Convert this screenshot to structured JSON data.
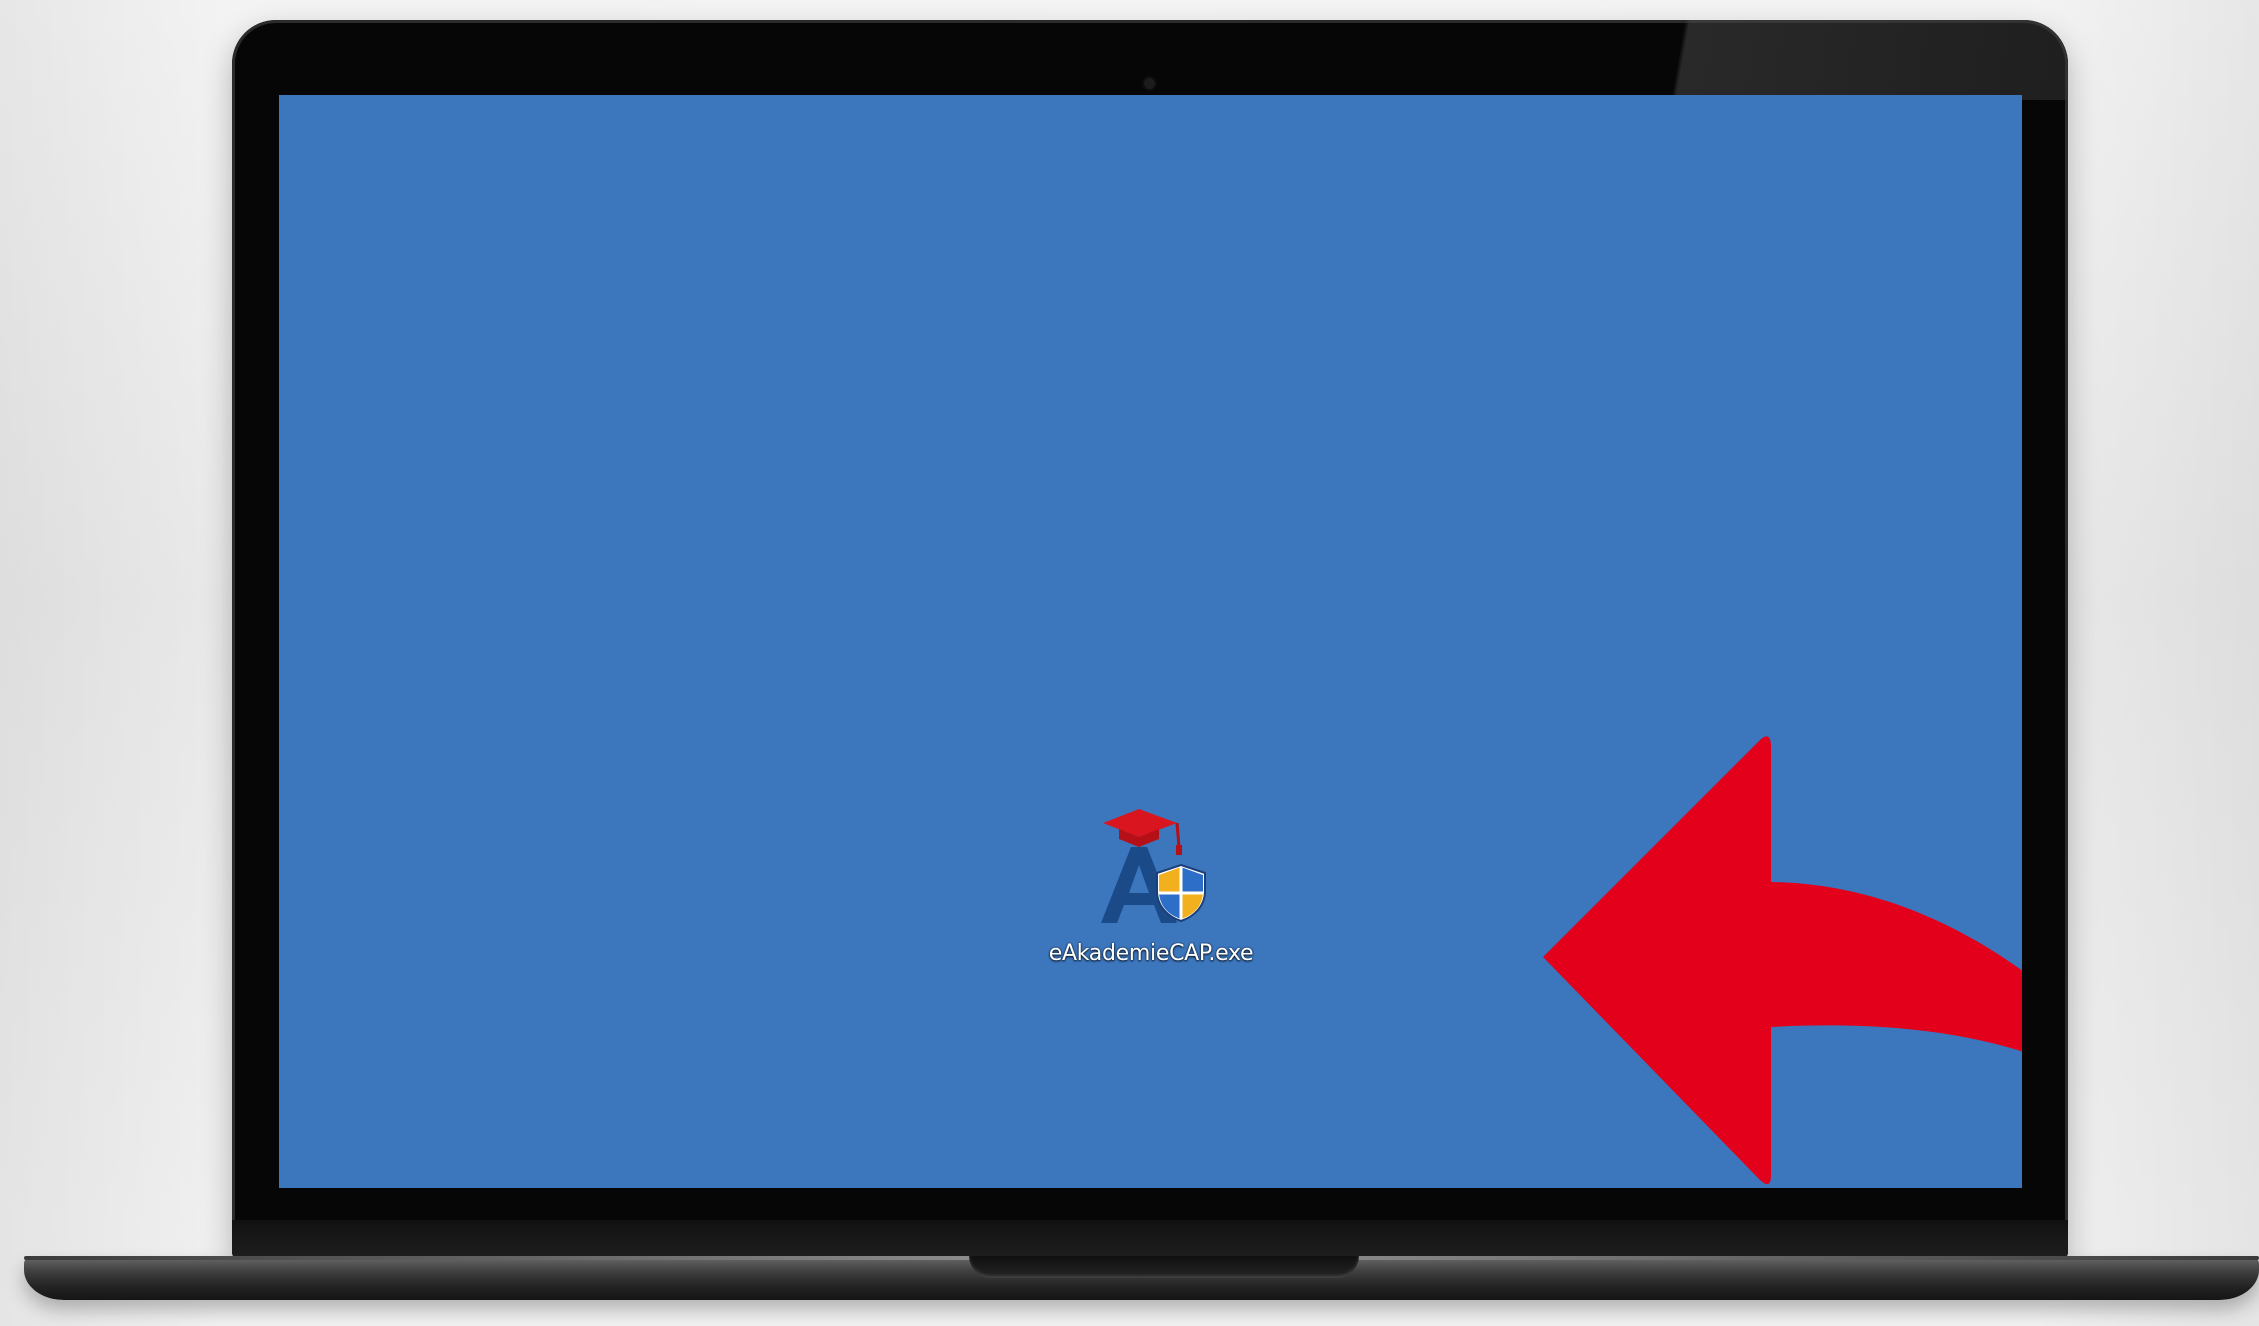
{
  "desktop": {
    "background_color": "#3c76bd",
    "icons": [
      {
        "label": "eAkademieCAP.exe",
        "icon": "eakademie-app-icon-with-uac-shield"
      }
    ]
  },
  "annotation": {
    "type": "curved-arrow",
    "color": "#e3001b",
    "points_to": "eAkademieCAP.exe"
  },
  "device": {
    "type": "laptop"
  }
}
